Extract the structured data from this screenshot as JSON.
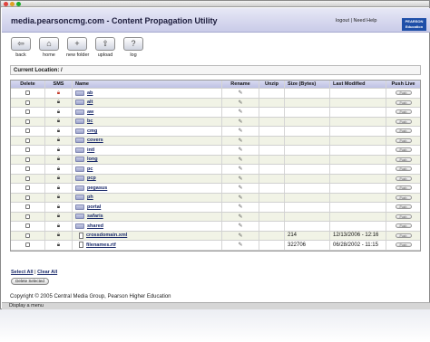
{
  "app": {
    "title": "media.pearsoncmg.com - Content Propagation Utility",
    "logout": "logout",
    "sep": "|",
    "need_help": "Need Help",
    "logo_line1": "PEARSON",
    "logo_line2": "Education"
  },
  "toolbar": [
    {
      "label": "back",
      "icon": "back-icon",
      "glyph": "⇦"
    },
    {
      "label": "home",
      "icon": "home-icon",
      "glyph": "⌂"
    },
    {
      "label": "new folder",
      "icon": "new-folder-icon",
      "glyph": "+"
    },
    {
      "label": "upload",
      "icon": "upload-icon",
      "glyph": "⇧"
    },
    {
      "label": "log",
      "icon": "log-icon",
      "glyph": "?"
    }
  ],
  "location": {
    "label": "Current Location:",
    "path": "/"
  },
  "columns": [
    "Delete",
    "SMS",
    "Name",
    "Rename",
    "Unzip",
    "Size (Bytes)",
    "Last Modified",
    "Push Live"
  ],
  "rows": [
    {
      "name": "ab",
      "type": "folder",
      "size": "",
      "modified": "",
      "lock": "red"
    },
    {
      "name": "alt",
      "type": "folder",
      "size": "",
      "modified": "",
      "lock": "grey"
    },
    {
      "name": "aw",
      "type": "folder",
      "size": "",
      "modified": "",
      "lock": "grey"
    },
    {
      "name": "bc",
      "type": "folder",
      "size": "",
      "modified": "",
      "lock": "grey"
    },
    {
      "name": "cmg",
      "type": "folder",
      "size": "",
      "modified": "",
      "lock": "grey"
    },
    {
      "name": "covers",
      "type": "folder",
      "size": "",
      "modified": "",
      "lock": "grey"
    },
    {
      "name": "intl",
      "type": "folder",
      "size": "",
      "modified": "",
      "lock": "grey"
    },
    {
      "name": "long",
      "type": "folder",
      "size": "",
      "modified": "",
      "lock": "grey"
    },
    {
      "name": "pc",
      "type": "folder",
      "size": "",
      "modified": "",
      "lock": "grey"
    },
    {
      "name": "pcp",
      "type": "folder",
      "size": "",
      "modified": "",
      "lock": "grey"
    },
    {
      "name": "pegasus",
      "type": "folder",
      "size": "",
      "modified": "",
      "lock": "grey"
    },
    {
      "name": "ph",
      "type": "folder",
      "size": "",
      "modified": "",
      "lock": "grey"
    },
    {
      "name": "portal",
      "type": "folder",
      "size": "",
      "modified": "",
      "lock": "grey"
    },
    {
      "name": "safaris",
      "type": "folder",
      "size": "",
      "modified": "",
      "lock": "grey"
    },
    {
      "name": "shared",
      "type": "folder",
      "size": "",
      "modified": "",
      "lock": "grey"
    },
    {
      "name": "crossdomain.xml",
      "type": "file",
      "size": "214",
      "modified": "12/13/2006 - 12:16",
      "lock": "grey"
    },
    {
      "name": "filenames.rtf",
      "type": "file",
      "size": "322706",
      "modified": "06/28/2002 - 11:15",
      "lock": "grey"
    }
  ],
  "push_label": "Push",
  "select_all": "Select All",
  "clear_all": "Clear All",
  "delete_selected": "Delete Selected",
  "copyright": "Copyright © 2005 Central Media Group, Pearson Higher Education",
  "status": "Display a menu"
}
